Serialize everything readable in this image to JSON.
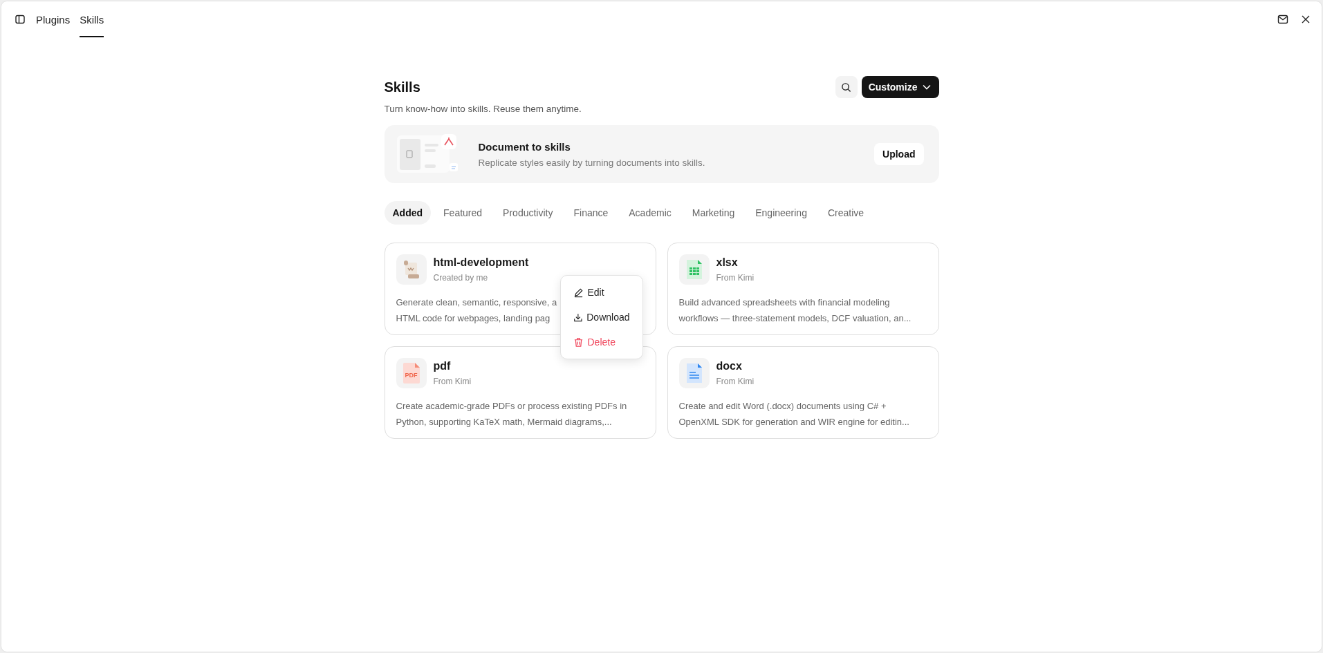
{
  "top_bar": {
    "tabs": [
      {
        "label": "Plugins",
        "selected": false
      },
      {
        "label": "Skills",
        "selected": true
      }
    ]
  },
  "header": {
    "title": "Skills",
    "subtitle": "Turn know-how into skills. Reuse them anytime.",
    "customize_button": "Customize"
  },
  "banner": {
    "title": "Document to skills",
    "description": "Replicate styles easily by turning documents into skills.",
    "button": "Upload"
  },
  "categories": [
    {
      "label": "Added",
      "selected": true
    },
    {
      "label": "Featured",
      "selected": false
    },
    {
      "label": "Productivity",
      "selected": false
    },
    {
      "label": "Finance",
      "selected": false
    },
    {
      "label": "Academic",
      "selected": false
    },
    {
      "label": "Marketing",
      "selected": false
    },
    {
      "label": "Engineering",
      "selected": false
    },
    {
      "label": "Creative",
      "selected": false
    }
  ],
  "cards": [
    {
      "kind": "html",
      "title": "html-development",
      "source": "Created by me",
      "description_lines": [
        "Generate clean, semantic, responsive, a",
        "HTML code for webpages, landing pag"
      ]
    },
    {
      "kind": "xlsx",
      "title": "xlsx",
      "source": "From Kimi",
      "description_lines": [
        "Build advanced spreadsheets with financial modeling",
        "workflows — three-statement models, DCF valuation, an..."
      ]
    },
    {
      "kind": "pdf",
      "title": "pdf",
      "source": "From Kimi",
      "icon_text": "PDF",
      "description_lines": [
        "Create academic-grade PDFs or process existing PDFs in",
        "Python, supporting KaTeX math, Mermaid diagrams,..."
      ]
    },
    {
      "kind": "docx",
      "title": "docx",
      "source": "From Kimi",
      "description_lines": [
        "Create and edit Word (.docx) documents using C# +",
        "OpenXML SDK for generation and WIR engine for editin..."
      ]
    }
  ],
  "context_menu": {
    "items": [
      {
        "kind": "edit",
        "label": "Edit"
      },
      {
        "kind": "download",
        "label": "Download"
      },
      {
        "kind": "delete",
        "label": "Delete"
      }
    ]
  }
}
